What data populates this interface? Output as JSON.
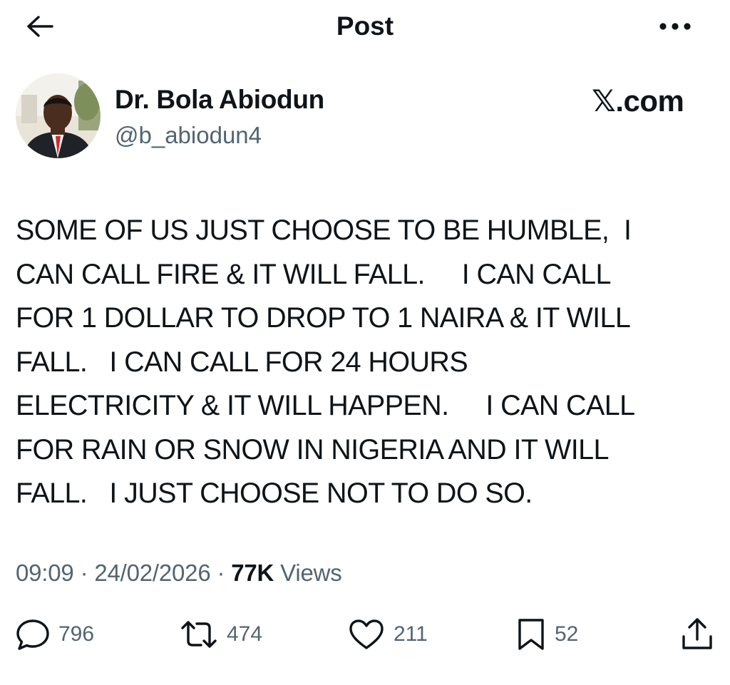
{
  "header": {
    "title": "Post",
    "back_icon": "arrow-left-icon",
    "more_icon": "more-horizontal-icon"
  },
  "author": {
    "name": "Dr. Bola Abiodun",
    "handle": "@b_abiodun4",
    "avatar_icon": "profile-photo"
  },
  "watermark": "𝕏.com",
  "post": {
    "text": "SOME OF US JUST CHOOSE TO BE HUMBLE,  I\nCAN CALL FIRE & IT WILL FALL.     I CAN CALL\nFOR 1 DOLLAR TO DROP TO 1 NAIRA & IT WILL\nFALL.   I CAN CALL FOR 24 HOURS\nELECTRICITY & IT WILL HAPPEN.     I CAN CALL\nFOR RAIN OR SNOW IN NIGERIA AND IT WILL\nFALL.   I JUST CHOOSE NOT TO DO SO."
  },
  "meta": {
    "time": "09:09",
    "date": "24/02/2026",
    "separator": "·",
    "views_count": "77K",
    "views_label": "Views"
  },
  "actions": {
    "replies": "796",
    "reposts": "474",
    "likes": "211",
    "bookmarks": "52"
  },
  "colors": {
    "text": "#0f1419",
    "secondary": "#536471",
    "background": "#ffffff"
  }
}
